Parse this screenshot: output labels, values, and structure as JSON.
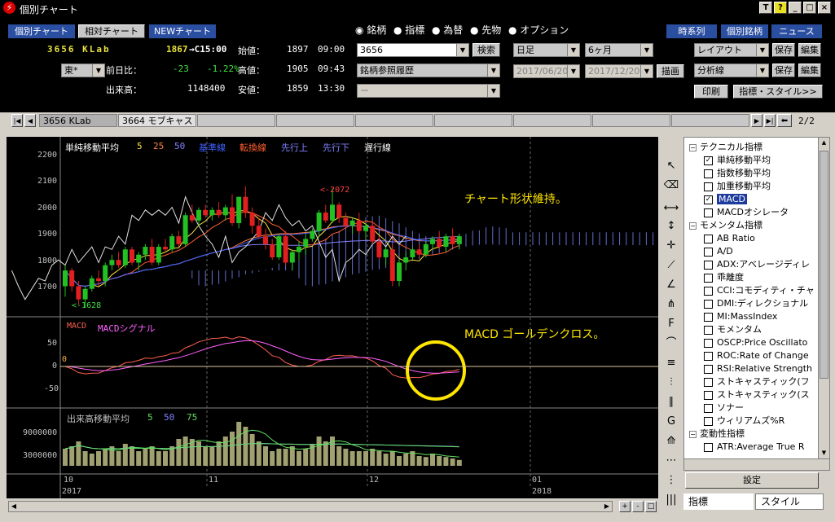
{
  "window": {
    "title": "個別チャート"
  },
  "toolbar": {
    "btn_individual": "個別チャート",
    "btn_relative": "相対チャート",
    "btn_new": "NEWチャート"
  },
  "stock": {
    "code_name": "3656 KLab",
    "exchange": "東*",
    "price": "1867",
    "arrow": "→C15:00",
    "prev_label": "前日比：",
    "change": "-23",
    "change_pct": "-1.22%",
    "volume_label": "出来高：",
    "volume": "1148400",
    "open_label": "始値：",
    "open": "1897",
    "open_time": "09:00",
    "high_label": "高値：",
    "high": "1905",
    "high_time": "09:43",
    "low_label": "安値：",
    "low": "1859",
    "low_time": "13:30"
  },
  "markets": {
    "r1": "銘柄",
    "r2": "指標",
    "r3": "為替",
    "r4": "先物",
    "r5": "オプション"
  },
  "search": {
    "code_value": "3656",
    "search_btn": "検索",
    "history": "銘柄参照履歴",
    "dash": "ー"
  },
  "period": {
    "interval": "日足",
    "range": "6ヶ月",
    "from": "2017/06/20",
    "to": "2017/12/20",
    "draw_btn": "描画"
  },
  "right": {
    "timeseries": "時系列",
    "indiv_stock": "個別銘柄",
    "news": "ニュース",
    "layout": "レイアウト",
    "save1": "保存",
    "edit1": "編集",
    "analysis": "分析線",
    "save2": "保存",
    "edit2": "編集",
    "print": "印刷",
    "indicator_style": "指標・スタイル>>"
  },
  "tabs": {
    "t1": "3656 KLab",
    "t2": "3664 モブキャス",
    "page": "2/2"
  },
  "chart_labels": {
    "sma": "単純移動平均",
    "p5": "5",
    "p25": "25",
    "p50": "50",
    "kijun": "基準線",
    "tenkan": "転換線",
    "senkou_a": "先行上",
    "senkou_b": "先行下",
    "chikou": "遅行線",
    "hi_label": "2072",
    "lo_label": "1628",
    "note1": "チャート形状維持。",
    "macd": "MACD",
    "macd_sig": "MACDシグナル",
    "note2": "MACD ゴールデンクロス。",
    "vol_ma": "出来高移動平均",
    "v5": "5",
    "v50": "50",
    "v75": "75",
    "x10": "10",
    "x11": "11",
    "x12": "12",
    "x01": "01",
    "y2017": "2017",
    "y2018": "2018"
  },
  "yaxis": {
    "p2200": "2200",
    "p2100": "2100",
    "p2000": "2000",
    "p1900": "1900",
    "p1800": "1800",
    "p1700": "1700",
    "m50": "50",
    "m0": "0",
    "mn50": "-50",
    "v9": "9000000",
    "v3": "3000000",
    "zero": "0"
  },
  "tree": {
    "g1": "テクニカル指標",
    "i1": "単純移動平均",
    "i2": "指数移動平均",
    "i3": "加重移動平均",
    "i4": "MACD",
    "i5": "MACDオシレータ",
    "g2": "モメンタム指標",
    "m1": "AB Ratio",
    "m2": "A/D",
    "m3": "ADX:アベレージディレ",
    "m4": "乖離度",
    "m5": "CCI:コモディティ・チャ",
    "m6": "DMI:ディレクショナル",
    "m7": "MI:MassIndex",
    "m8": "モメンタム",
    "m9": "OSCP:Price Oscillato",
    "m10": "ROC:Rate of Change",
    "m11": "RSI:Relative Strength",
    "m12": "ストキャスティック(フ",
    "m13": "ストキャスティック(ス",
    "m14": "ソナー",
    "m15": "ウィリアムズ%R",
    "g3": "変動性指標",
    "v1": "ATR:Average True R"
  },
  "panel_btns": {
    "settings": "設定",
    "tab_indicator": "指標",
    "tab_style": "スタイル"
  },
  "candles": [
    [
      1700,
      1780,
      1660,
      1760
    ],
    [
      1760,
      1770,
      1680,
      1700
    ],
    [
      1700,
      1720,
      1630,
      1650
    ],
    [
      1650,
      1700,
      1620,
      1690
    ],
    [
      1690,
      1740,
      1680,
      1730
    ],
    [
      1730,
      1760,
      1700,
      1720
    ],
    [
      1720,
      1790,
      1700,
      1780
    ],
    [
      1780,
      1820,
      1760,
      1800
    ],
    [
      1800,
      1830,
      1770,
      1780
    ],
    [
      1780,
      1850,
      1770,
      1840
    ],
    [
      1840,
      1850,
      1780,
      1790
    ],
    [
      1790,
      1830,
      1760,
      1820
    ],
    [
      1820,
      1860,
      1800,
      1850
    ],
    [
      1850,
      1880,
      1780,
      1790
    ],
    [
      1790,
      1860,
      1780,
      1850
    ],
    [
      1850,
      1880,
      1830,
      1840
    ],
    [
      1840,
      1900,
      1830,
      1890
    ],
    [
      1890,
      1910,
      1850,
      1860
    ],
    [
      1860,
      1980,
      1850,
      1970
    ],
    [
      1970,
      2010,
      1940,
      1950
    ],
    [
      1950,
      2000,
      1930,
      1990
    ],
    [
      1990,
      2010,
      1960,
      1970
    ],
    [
      1970,
      2000,
      1950,
      1990
    ],
    [
      1990,
      2020,
      1960,
      1970
    ],
    [
      1970,
      2010,
      1950,
      2000
    ],
    [
      2000,
      2050,
      1930,
      1940
    ],
    [
      1940,
      2040,
      1920,
      2040
    ],
    [
      2040,
      2080,
      1960,
      1980
    ],
    [
      1980,
      2000,
      1900,
      1930
    ],
    [
      1930,
      1960,
      1880,
      1890
    ],
    [
      1890,
      1920,
      1840,
      1860
    ],
    [
      1860,
      1880,
      1800,
      1810
    ],
    [
      1810,
      1900,
      1800,
      1890
    ],
    [
      1890,
      1910,
      1780,
      1790
    ],
    [
      1790,
      1840,
      1760,
      1830
    ],
    [
      1830,
      1870,
      1800,
      1850
    ],
    [
      1850,
      1900,
      1820,
      1880
    ],
    [
      1880,
      1920,
      1870,
      1910
    ],
    [
      1910,
      1990,
      1890,
      1980
    ],
    [
      1980,
      2010,
      1940,
      1950
    ],
    [
      1950,
      2072,
      1940,
      2010
    ],
    [
      2010,
      2020,
      1940,
      1960
    ],
    [
      1960,
      1980,
      1920,
      1930
    ],
    [
      1930,
      1960,
      1900,
      1950
    ],
    [
      1950,
      1980,
      1900,
      1910
    ],
    [
      1910,
      1940,
      1880,
      1930
    ],
    [
      1930,
      1950,
      1860,
      1870
    ],
    [
      1870,
      1890,
      1800,
      1810
    ],
    [
      1810,
      1850,
      1780,
      1840
    ],
    [
      1840,
      1860,
      1700,
      1720
    ],
    [
      1720,
      1800,
      1700,
      1790
    ],
    [
      1790,
      1830,
      1760,
      1810
    ],
    [
      1810,
      1850,
      1800,
      1840
    ],
    [
      1840,
      1860,
      1810,
      1820
    ],
    [
      1820,
      1870,
      1810,
      1860
    ],
    [
      1860,
      1890,
      1840,
      1880
    ],
    [
      1880,
      1910,
      1840,
      1850
    ],
    [
      1850,
      1900,
      1830,
      1890
    ],
    [
      1890,
      1920,
      1850,
      1860
    ],
    [
      1860,
      1900,
      1840,
      1890
    ]
  ],
  "volumes": [
    3.5,
    4,
    5,
    3,
    2.5,
    3,
    3.5,
    4,
    3,
    4.5,
    4,
    3,
    3.5,
    4,
    3,
    3,
    4,
    5.5,
    6,
    5.5,
    5,
    4,
    4,
    5,
    6,
    7,
    9,
    8,
    6.5,
    5,
    4,
    3,
    3.5,
    3.5,
    4,
    3,
    3.5,
    4.5,
    6,
    5,
    6,
    4,
    3.5,
    3,
    3,
    3,
    3.5,
    3,
    2.5,
    3,
    2,
    2.5,
    3,
    2,
    1.8,
    2.5,
    2,
    1.8,
    1.5,
    1.2
  ]
}
